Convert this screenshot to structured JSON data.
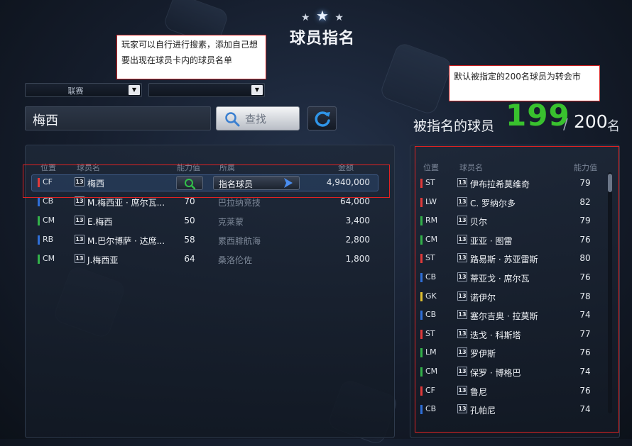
{
  "title": "球员指名",
  "annotations": {
    "note1": "玩家可以自行进行搜素，添加自己想要出现在球员卡内的球员名单",
    "note2": "默认被指定的200名球员为转会市"
  },
  "filters": {
    "league_label": "联赛",
    "team_label": ""
  },
  "search": {
    "value": "梅西",
    "button_label": "查找"
  },
  "counter": {
    "label": "被指名的球员",
    "current": "199",
    "slash": "/",
    "max": "200",
    "unit": "名"
  },
  "search_results": {
    "headers": {
      "position": "位置",
      "name": "球员名",
      "ability": "能力值",
      "club": "所属",
      "fee": "金额"
    },
    "nominate_label": "指名球员",
    "rows": [
      {
        "pos": "CF",
        "card": "13",
        "name": "梅西",
        "ability": "",
        "club": "",
        "fee": "4,940,000",
        "color": "#e03a3a"
      },
      {
        "pos": "CB",
        "card": "13",
        "name": "M.梅西亚 · 席尔瓦...",
        "ability": "70",
        "club": "巴拉纳竞技",
        "fee": "64,000",
        "color": "#2f6fd8"
      },
      {
        "pos": "CM",
        "card": "13",
        "name": "E.梅西",
        "ability": "50",
        "club": "克莱蒙",
        "fee": "3,400",
        "color": "#33b24a"
      },
      {
        "pos": "RB",
        "card": "13",
        "name": "M.巴尔博萨 · 达席...",
        "ability": "58",
        "club": "累西腓航海",
        "fee": "2,800",
        "color": "#2f6fd8"
      },
      {
        "pos": "CM",
        "card": "13",
        "name": "J.梅西亚",
        "ability": "64",
        "club": "桑洛伦佐",
        "fee": "1,800",
        "color": "#33b24a"
      }
    ]
  },
  "nominated": {
    "headers": {
      "position": "位置",
      "name": "球员名",
      "ability": "能力值"
    },
    "rows": [
      {
        "pos": "ST",
        "card": "13",
        "name": "伊布拉希莫维奇",
        "ability": "79",
        "color": "#e03a3a"
      },
      {
        "pos": "LW",
        "card": "13",
        "name": "C. 罗纳尔多",
        "ability": "82",
        "color": "#e03a3a"
      },
      {
        "pos": "RM",
        "card": "13",
        "name": "贝尔",
        "ability": "79",
        "color": "#33b24a"
      },
      {
        "pos": "CM",
        "card": "13",
        "name": "亚亚 · 图雷",
        "ability": "76",
        "color": "#33b24a"
      },
      {
        "pos": "ST",
        "card": "13",
        "name": "路易斯 · 苏亚雷斯",
        "ability": "80",
        "color": "#e03a3a"
      },
      {
        "pos": "CB",
        "card": "13",
        "name": "蒂亚戈 · 席尔瓦",
        "ability": "76",
        "color": "#2f6fd8"
      },
      {
        "pos": "GK",
        "card": "13",
        "name": "诺伊尔",
        "ability": "78",
        "color": "#e0c030"
      },
      {
        "pos": "CB",
        "card": "13",
        "name": "塞尔吉奥 · 拉莫斯",
        "ability": "74",
        "color": "#2f6fd8"
      },
      {
        "pos": "ST",
        "card": "13",
        "name": "迭戈 · 科斯塔",
        "ability": "77",
        "color": "#e03a3a"
      },
      {
        "pos": "LM",
        "card": "13",
        "name": "罗伊斯",
        "ability": "76",
        "color": "#33b24a"
      },
      {
        "pos": "CM",
        "card": "13",
        "name": "保罗 · 博格巴",
        "ability": "74",
        "color": "#33b24a"
      },
      {
        "pos": "CF",
        "card": "13",
        "name": "鲁尼",
        "ability": "76",
        "color": "#e03a3a"
      },
      {
        "pos": "CB",
        "card": "13",
        "name": "孔帕尼",
        "ability": "74",
        "color": "#2f6fd8"
      }
    ]
  }
}
